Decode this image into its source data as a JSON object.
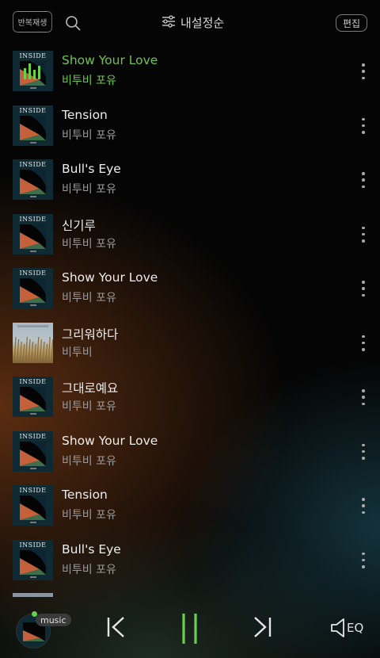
{
  "header": {
    "repeat_label": "반복재생",
    "sort_label": "내설정순",
    "edit_label": "편집"
  },
  "playlist": [
    {
      "title": "Show Your Love",
      "artist": "비투비 포유",
      "cover": "inside",
      "active": true
    },
    {
      "title": "Tension",
      "artist": "비투비 포유",
      "cover": "inside",
      "active": false
    },
    {
      "title": "Bull's Eye",
      "artist": "비투비 포유",
      "cover": "inside",
      "active": false
    },
    {
      "title": "신기루",
      "artist": "비투비 포유",
      "cover": "inside",
      "active": false
    },
    {
      "title": "Show Your Love",
      "artist": "비투비 포유",
      "cover": "inside",
      "active": false
    },
    {
      "title": "그리워하다",
      "artist": "비투비",
      "cover": "field",
      "active": false
    },
    {
      "title": "그대로예요",
      "artist": "비투비 포유",
      "cover": "inside",
      "active": false
    },
    {
      "title": "Show Your Love",
      "artist": "비투비 포유",
      "cover": "inside",
      "active": false
    },
    {
      "title": "Tension",
      "artist": "비투비 포유",
      "cover": "inside",
      "active": false
    },
    {
      "title": "Bull's Eye",
      "artist": "비투비 포유",
      "cover": "inside",
      "active": false
    }
  ],
  "cover_text": "INSIDE",
  "player": {
    "badge": "music",
    "eq_label": "EQ"
  },
  "colors": {
    "accent": "#6cc64a",
    "background": "#050505"
  }
}
